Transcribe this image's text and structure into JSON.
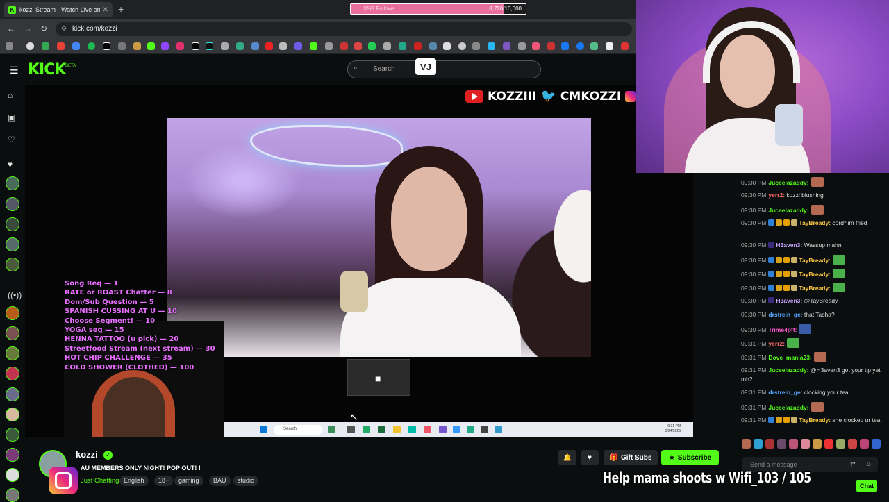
{
  "browser": {
    "tab_title": "kozzi Stream - Watch Live on Ki",
    "tab_favicon": "K",
    "new_tab": "+",
    "close": "✕",
    "url": "kick.com/kozzi",
    "goal": {
      "label": "X9G Follows",
      "current": "8,720",
      "separator": "/",
      "target": "10,000",
      "progress": 0.872
    }
  },
  "kick": {
    "logo": "KICK",
    "beta": "BETA",
    "search_placeholder": "Search",
    "overlay_badge": "VJ"
  },
  "socials": {
    "youtube": "KOZZIII",
    "twitter": "CMKOZZI"
  },
  "menu": [
    "Song Req — 1",
    "RATE or ROAST Chatter — 8",
    "Dom/Sub Question — 5",
    "SPANISH CUSSING AT U — 10",
    "Choose Segment! — 10",
    "YOGA seg — 15",
    "HENNA TATTOO (u pick) — 20",
    "Streetfood Stream (next stream) — 30",
    "HOT CHIP CHALLENGE — 35",
    "COLD SHOWER (CLOTHED) — 100"
  ],
  "taskbar": {
    "search": "Search",
    "time": "9:31 PM",
    "date": "3/24/2026"
  },
  "chat": {
    "messages": [
      {
        "time": "09:30 PM",
        "user": "Juceelazaddy:",
        "color": "#53fc18",
        "text": "",
        "emote": "#b46a52",
        "badges": []
      },
      {
        "time": "09:30 PM",
        "user": "yerr2:",
        "color": "#ff6b6b",
        "text": "kozzi blushing",
        "badges": []
      },
      {
        "time": "09:30 PM",
        "user": "Juceelazaddy:",
        "color": "#53fc18",
        "text": "",
        "emote": "#b46a52",
        "badges": []
      },
      {
        "time": "09:30 PM",
        "user": "TayBready:",
        "color": "#f5c542",
        "text": "cord* im fried",
        "badges": [
          "#2f7fd6",
          "#d9a21b",
          "#e5a000",
          "#c9b26a"
        ]
      },
      {
        "time": "09:30 PM",
        "user": "H3aven3:",
        "color": "#c8a4ff",
        "text": "Wassup mahn",
        "badges": [
          "#3b2a7a"
        ]
      },
      {
        "time": "09:30 PM",
        "user": "TayBready:",
        "color": "#f5c542",
        "text": "",
        "emote": "#49b04a",
        "badges": [
          "#2f7fd6",
          "#d9a21b",
          "#e5a000",
          "#c9b26a"
        ]
      },
      {
        "time": "09:30 PM",
        "user": "TayBready:",
        "color": "#f5c542",
        "text": "",
        "emote": "#49b04a",
        "badges": [
          "#2f7fd6",
          "#d9a21b",
          "#e5a000",
          "#c9b26a"
        ]
      },
      {
        "time": "09:30 PM",
        "user": "TayBready:",
        "color": "#f5c542",
        "text": "",
        "emote": "#49b04a",
        "badges": [
          "#2f7fd6",
          "#d9a21b",
          "#e5a000",
          "#c9b26a"
        ]
      },
      {
        "time": "09:30 PM",
        "user": "H3aven3:",
        "color": "#c8a4ff",
        "text": "@TayBready",
        "badges": [
          "#3b2a7a"
        ]
      },
      {
        "time": "09:30 PM",
        "user": "drstrein_ge:",
        "color": "#5aa7ff",
        "text": "that Tasha?",
        "badges": []
      },
      {
        "time": "09:30 PM",
        "user": "Trime4pff:",
        "color": "#ff5ad0",
        "text": "",
        "emote": "#3a5ca8",
        "badges": []
      },
      {
        "time": "09:31 PM",
        "user": "yerr2:",
        "color": "#ff6b6b",
        "text": "",
        "emote": "#49b04a",
        "badges": []
      },
      {
        "time": "09:31 PM",
        "user": "Dove_mania23:",
        "color": "#53fc18",
        "text": "",
        "emote": "#b46a52",
        "badges": []
      },
      {
        "time": "09:31 PM",
        "user": "Juceelazaddy:",
        "color": "#53fc18",
        "text": "@H3aven3 got your tip yet mh?",
        "badges": []
      },
      {
        "time": "09:31 PM",
        "user": "drstrein_ge:",
        "color": "#5aa7ff",
        "text": "clocking your tea",
        "badges": []
      },
      {
        "time": "09:31 PM",
        "user": "Juceelazaddy:",
        "color": "#53fc18",
        "text": "",
        "emote": "#b46a52",
        "badges": []
      },
      {
        "time": "09:31 PM",
        "user": "TayBready:",
        "color": "#f5c542",
        "text": "she clocked ur tea",
        "badges": [
          "#2f7fd6",
          "#d9a21b",
          "#e5a000",
          "#c9b26a"
        ]
      }
    ],
    "input_placeholder": "Send a message",
    "send_label": "Chat"
  },
  "channel": {
    "name": "kozzi",
    "verified": "✓",
    "title": "AU MEMBERS ONLY NIGHT! POP OUT! !",
    "category": "Just Chatting",
    "tags": [
      "English",
      "18+",
      "gaming",
      "BAU",
      "studio"
    ],
    "gift_label": "Gift Subs",
    "subscribe_label": "Subscribe",
    "overlay_goal": "Help mama shoots w Wifi_103 / 105"
  },
  "colors": {
    "accent": "#53fc18",
    "menu_text": "#e86fff"
  }
}
